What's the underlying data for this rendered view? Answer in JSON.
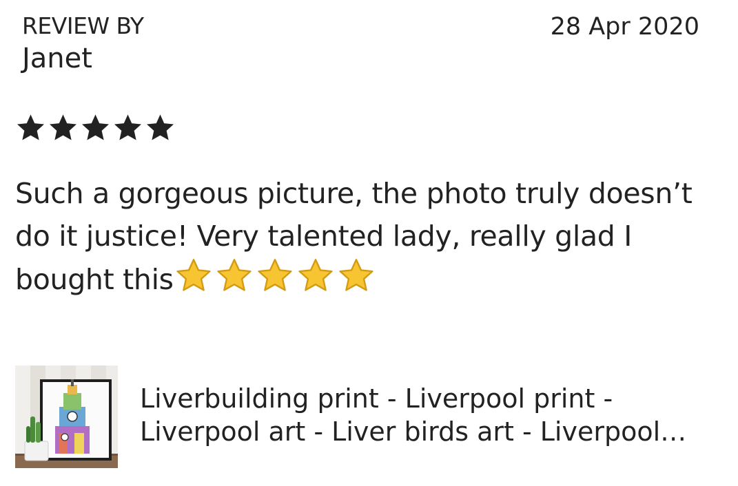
{
  "review": {
    "label": "REVIEW BY",
    "reviewer": "Janet",
    "date": "28 Apr 2020",
    "rating": 5,
    "rating_max": 5,
    "rating_icon": "star-icon",
    "text": "Such a gorgeous picture, the photo truly doesn’t do it justice! Very talented lady, really glad I bought this",
    "emoji_stars": 5,
    "emoji_icon": "star-emoji-icon"
  },
  "product": {
    "title": "Liverbuilding print - Liverpool print - Liverpool art - Liver birds art - Liverpool skyline print - Liverpool Gifts - Liverpool Poster",
    "thumbnail_icon": "product-thumbnail"
  },
  "colors": {
    "text": "#222222",
    "star_filled": "#222222",
    "emoji_star": "#F7C531"
  }
}
